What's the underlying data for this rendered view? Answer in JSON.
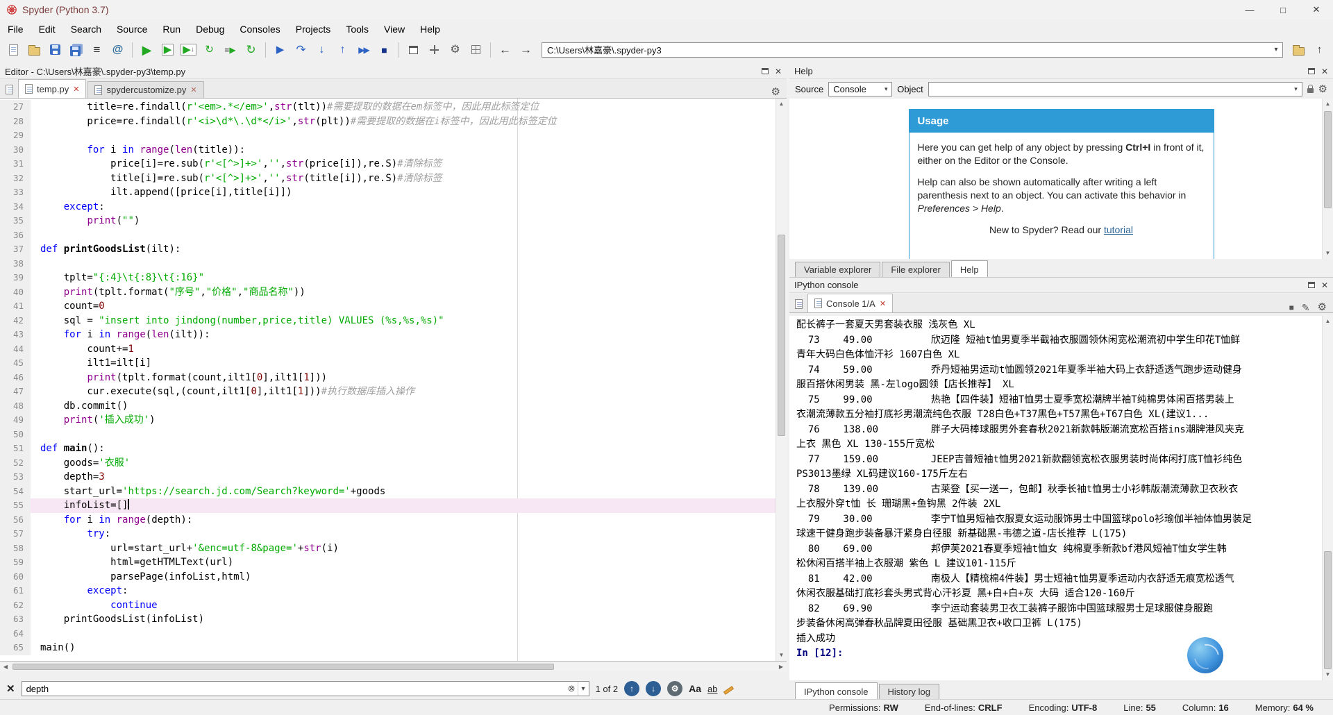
{
  "window": {
    "title": "Spyder (Python 3.7)"
  },
  "menu_bar": {
    "items": [
      "File",
      "Edit",
      "Search",
      "Source",
      "Run",
      "Debug",
      "Consoles",
      "Projects",
      "Tools",
      "View",
      "Help"
    ]
  },
  "toolbar": {
    "working_directory": "C:\\Users\\林嘉豪\\.spyder-py3"
  },
  "editor": {
    "pane_title": "Editor - C:\\Users\\林嘉豪\\.spyder-py3\\temp.py",
    "tabs": [
      {
        "label": "temp.py"
      },
      {
        "label": "spydercustomize.py"
      }
    ],
    "current_line": 55,
    "code_lines": [
      {
        "n": 27,
        "s": [
          [
            "p",
            "        title=re.findall("
          ],
          [
            "s",
            "r'<em>.*</em>'"
          ],
          [
            "p",
            ","
          ],
          [
            "b",
            "str"
          ],
          [
            "p",
            "(tlt))"
          ],
          [
            "c",
            "#需要提取的数据在em标签中，因此用此标签定位"
          ]
        ]
      },
      {
        "n": 28,
        "s": [
          [
            "p",
            "        price=re.findall("
          ],
          [
            "s",
            "r'<i>\\d*\\.\\d*</i>'"
          ],
          [
            "p",
            ","
          ],
          [
            "b",
            "str"
          ],
          [
            "p",
            "(plt))"
          ],
          [
            "c",
            "#需要提取的数据在i标签中，因此用此标签定位"
          ]
        ]
      },
      {
        "n": 29,
        "s": []
      },
      {
        "n": 30,
        "s": [
          [
            "p",
            "        "
          ],
          [
            "k",
            "for"
          ],
          [
            "p",
            " i "
          ],
          [
            "k",
            "in"
          ],
          [
            "p",
            " "
          ],
          [
            "b",
            "range"
          ],
          [
            "p",
            "("
          ],
          [
            "b",
            "len"
          ],
          [
            "p",
            "(title)):"
          ]
        ]
      },
      {
        "n": 31,
        "s": [
          [
            "p",
            "            price[i]=re.sub("
          ],
          [
            "s",
            "r'<[^>]+>'"
          ],
          [
            "p",
            ","
          ],
          [
            "s",
            "''"
          ],
          [
            "p",
            ","
          ],
          [
            "b",
            "str"
          ],
          [
            "p",
            "(price[i]),re.S)"
          ],
          [
            "c",
            "#清除标签"
          ]
        ]
      },
      {
        "n": 32,
        "s": [
          [
            "p",
            "            title[i]=re.sub("
          ],
          [
            "s",
            "r'<[^>]+>'"
          ],
          [
            "p",
            ","
          ],
          [
            "s",
            "''"
          ],
          [
            "p",
            ","
          ],
          [
            "b",
            "str"
          ],
          [
            "p",
            "(title[i]),re.S)"
          ],
          [
            "c",
            "#清除标签"
          ]
        ]
      },
      {
        "n": 33,
        "s": [
          [
            "p",
            "            ilt.append([price[i],title[i]])"
          ]
        ]
      },
      {
        "n": 34,
        "s": [
          [
            "p",
            "    "
          ],
          [
            "k",
            "except"
          ],
          [
            "p",
            ":"
          ]
        ]
      },
      {
        "n": 35,
        "s": [
          [
            "p",
            "        "
          ],
          [
            "b",
            "print"
          ],
          [
            "p",
            "("
          ],
          [
            "s",
            "\"\""
          ],
          [
            "p",
            ")"
          ]
        ]
      },
      {
        "n": 36,
        "s": []
      },
      {
        "n": 37,
        "s": [
          [
            "k",
            "def"
          ],
          [
            "p",
            " "
          ],
          [
            "d",
            "printGoodsList"
          ],
          [
            "p",
            "(ilt):"
          ]
        ]
      },
      {
        "n": 38,
        "s": []
      },
      {
        "n": 39,
        "s": [
          [
            "p",
            "    tplt="
          ],
          [
            "s",
            "\"{:4}\\t{:8}\\t{:16}\""
          ]
        ]
      },
      {
        "n": 40,
        "s": [
          [
            "p",
            "    "
          ],
          [
            "b",
            "print"
          ],
          [
            "p",
            "(tplt.format("
          ],
          [
            "s",
            "\"序号\""
          ],
          [
            "p",
            ","
          ],
          [
            "s",
            "\"价格\""
          ],
          [
            "p",
            ","
          ],
          [
            "s",
            "\"商品名称\""
          ],
          [
            "p",
            "))"
          ]
        ]
      },
      {
        "n": 41,
        "s": [
          [
            "p",
            "    count="
          ],
          [
            "n2",
            "0"
          ]
        ]
      },
      {
        "n": 42,
        "s": [
          [
            "p",
            "    sql = "
          ],
          [
            "s",
            "\"insert into jindong(number,price,title) VALUES (%s,%s,%s)\""
          ]
        ]
      },
      {
        "n": 43,
        "s": [
          [
            "p",
            "    "
          ],
          [
            "k",
            "for"
          ],
          [
            "p",
            " i "
          ],
          [
            "k",
            "in"
          ],
          [
            "p",
            " "
          ],
          [
            "b",
            "range"
          ],
          [
            "p",
            "("
          ],
          [
            "b",
            "len"
          ],
          [
            "p",
            "(ilt)):"
          ]
        ]
      },
      {
        "n": 44,
        "s": [
          [
            "p",
            "        count+="
          ],
          [
            "n2",
            "1"
          ]
        ]
      },
      {
        "n": 45,
        "s": [
          [
            "p",
            "        ilt1=ilt[i]"
          ]
        ]
      },
      {
        "n": 46,
        "s": [
          [
            "p",
            "        "
          ],
          [
            "b",
            "print"
          ],
          [
            "p",
            "(tplt.format(count,ilt1["
          ],
          [
            "n2",
            "0"
          ],
          [
            "p",
            "],ilt1["
          ],
          [
            "n2",
            "1"
          ],
          [
            "p",
            "]))"
          ]
        ]
      },
      {
        "n": 47,
        "s": [
          [
            "p",
            "        cur.execute(sql,(count,ilt1["
          ],
          [
            "n2",
            "0"
          ],
          [
            "p",
            "],ilt1["
          ],
          [
            "n2",
            "1"
          ],
          [
            "p",
            "]))"
          ],
          [
            "c",
            "#执行数据库插入操作"
          ]
        ]
      },
      {
        "n": 48,
        "s": [
          [
            "p",
            "    db.commit()"
          ]
        ]
      },
      {
        "n": 49,
        "s": [
          [
            "p",
            "    "
          ],
          [
            "b",
            "print"
          ],
          [
            "p",
            "("
          ],
          [
            "s",
            "'插入成功'"
          ],
          [
            "p",
            ")"
          ]
        ]
      },
      {
        "n": 50,
        "s": []
      },
      {
        "n": 51,
        "s": [
          [
            "k",
            "def"
          ],
          [
            "p",
            " "
          ],
          [
            "d",
            "main"
          ],
          [
            "p",
            "():"
          ]
        ]
      },
      {
        "n": 52,
        "s": [
          [
            "p",
            "    goods="
          ],
          [
            "s",
            "'衣服'"
          ]
        ]
      },
      {
        "n": 53,
        "s": [
          [
            "p",
            "    depth="
          ],
          [
            "n2",
            "3"
          ]
        ]
      },
      {
        "n": 54,
        "s": [
          [
            "p",
            "    start_url="
          ],
          [
            "s",
            "'https://search.jd.com/Search?keyword='"
          ],
          [
            "p",
            "+goods"
          ]
        ]
      },
      {
        "n": 55,
        "s": [
          [
            "p",
            "    infoList=[]"
          ]
        ]
      },
      {
        "n": 56,
        "s": [
          [
            "p",
            "    "
          ],
          [
            "k",
            "for"
          ],
          [
            "p",
            " i "
          ],
          [
            "k",
            "in"
          ],
          [
            "p",
            " "
          ],
          [
            "b",
            "range"
          ],
          [
            "p",
            "(depth):"
          ]
        ]
      },
      {
        "n": 57,
        "s": [
          [
            "p",
            "        "
          ],
          [
            "k",
            "try"
          ],
          [
            "p",
            ":"
          ]
        ]
      },
      {
        "n": 58,
        "s": [
          [
            "p",
            "            url=start_url+"
          ],
          [
            "s",
            "'&enc=utf-8&page='"
          ],
          [
            "p",
            "+"
          ],
          [
            "b",
            "str"
          ],
          [
            "p",
            "(i)"
          ]
        ]
      },
      {
        "n": 59,
        "s": [
          [
            "p",
            "            html=getHTMLText(url)"
          ]
        ]
      },
      {
        "n": 60,
        "s": [
          [
            "p",
            "            parsePage(infoList,html)"
          ]
        ]
      },
      {
        "n": 61,
        "s": [
          [
            "p",
            "        "
          ],
          [
            "k",
            "except"
          ],
          [
            "p",
            ":"
          ]
        ]
      },
      {
        "n": 62,
        "s": [
          [
            "p",
            "            "
          ],
          [
            "k",
            "continue"
          ]
        ]
      },
      {
        "n": 63,
        "s": [
          [
            "p",
            "    printGoodsList(infoList)"
          ]
        ]
      },
      {
        "n": 64,
        "s": []
      },
      {
        "n": 65,
        "s": [
          [
            "p",
            "main()"
          ]
        ]
      }
    ]
  },
  "help": {
    "pane_title": "Help",
    "source_label": "Source",
    "source_value": "Console",
    "object_label": "Object",
    "object_value": "",
    "usage": {
      "title": "Usage",
      "p1_pre": "Here you can get help of any object by pressing ",
      "p1_kbd": "Ctrl+I",
      "p1_post": " in front of it, either on the Editor or the Console.",
      "p2_pre": "Help can also be shown automatically after writing a left parenthesis next to an object. You can activate this behavior in ",
      "p2_em": "Preferences > Help",
      "p2_post": ".",
      "p3_pre": "New to Spyder? Read our ",
      "p3_link": "tutorial"
    },
    "dock_tabs": [
      "Variable explorer",
      "File explorer",
      "Help"
    ]
  },
  "console": {
    "pane_title": "IPython console",
    "tab_label": "Console 1/A",
    "output_lines": [
      "配长裤子一套夏天男套装衣服 浅灰色 XL",
      "  73    49.00          欣迈隆 短袖t恤男夏季半截袖衣服圆领休闲宽松潮流初中学生印花T恤鲜",
      "青年大码白色体恤汗衫 1607白色 XL",
      "  74    59.00          乔丹短袖男运动t恤圆领2021年夏季半袖大码上衣舒适透气跑步运动健身",
      "服百搭休闲男装 黑-左logo圆领【店长推荐】 XL",
      "  75    99.00          热艳【四件装】短袖T恤男士夏季宽松潮牌半袖T纯棉男体闲百搭男装上",
      "衣潮流薄款五分袖打底衫男潮流纯色衣服 T28白色+T37黑色+T57黑色+T67白色 XL(建议1...",
      "  76    138.00         胖子大码棒球服男外套春秋2021新款韩版潮流宽松百搭ins潮牌港风夹克",
      "上衣 黑色 XL 130-155斤宽松",
      "  77    159.00         JEEP吉普短袖t恤男2021新款翻领宽松衣服男装时尚体闲打底T恤衫纯色",
      "PS3013墨绿 XL码建议160-175斤左右",
      "  78    139.00         古莱登【买一送一，包邮】秋季长袖t恤男士小衫韩版潮流薄款卫衣秋衣",
      "上衣服外穿t恤 长 珊瑚黑+鱼钩黑 2件装 2XL",
      "  79    30.00          李宁T恤男短袖衣服夏女运动服饰男士中国篮球polo衫瑜伽半袖体恤男装足",
      "球速干健身跑步装备暴汗紧身白径服 新基础黑-韦德之道-店长推荐 L(175)",
      "  80    69.00          邦伊芙2021春夏季短袖t恤女 纯棉夏季新款bf港风短袖T恤女学生韩",
      "松休闲百搭半袖上衣服潮 紫色 L 建议101-115斤",
      "  81    42.00          南极人【精梳棉4件装】男士短袖t恤男夏季运动内衣舒适无痕宽松透气",
      "休闲衣服基础打底衫套头男式背心汗衫夏 黑+白+白+灰 大码 适合120-160斤",
      "  82    69.90          李宁运动套装男卫衣工装裤子服饰中国篮球服男士足球服健身服跑",
      "步装备休闲高弹春秋品牌夏田径服 基础黑卫衣+收口卫裤 L(175)",
      "插入成功",
      ""
    ],
    "prompt": "In [12]:",
    "bottom_tabs": [
      "IPython console",
      "History log"
    ]
  },
  "find_bar": {
    "query": "depth",
    "matches": "1 of 2"
  },
  "status_bar": {
    "permissions_label": "Permissions:",
    "permissions": "RW",
    "eol_label": "End-of-lines:",
    "eol": "CRLF",
    "encoding_label": "Encoding:",
    "encoding": "UTF-8",
    "line_label": "Line:",
    "line": "55",
    "column_label": "Column:",
    "column": "16",
    "memory_label": "Memory:",
    "memory": "64 %"
  },
  "colors": {
    "accent_blue": "#2e9bd6",
    "keyword": "#0000ff",
    "builtin": "#900090",
    "string": "#00aa00",
    "comment": "#9f9f9f",
    "number": "#800000",
    "current_line_bg": "#f7e6f3",
    "run_green": "#22a822",
    "debug_blue": "#2b62c4",
    "stop_blue": "#16348c",
    "prompt_blue": "#000080",
    "tab_close_red": "#c0392b"
  },
  "icons": {
    "minimize": "—",
    "maximize": "□",
    "close": "✕",
    "list": "≡",
    "at": "@",
    "run": "▶",
    "rerun": "↻",
    "restart": "↻",
    "debug": "▶",
    "step_over": "↷",
    "step_into": "↓",
    "step_out": "↑",
    "continue_run": "▶▶",
    "stop": "■",
    "gear": "⚙",
    "pencil": "✎",
    "back": "←",
    "forward": "→",
    "up": "↑",
    "dropdown": "▾",
    "clear": "⊗",
    "case": "Aa",
    "words": "ab",
    "scroll_up": "▲",
    "scroll_down": "▼",
    "scroll_left": "◀",
    "scroll_right": "▶",
    "square": "■"
  }
}
